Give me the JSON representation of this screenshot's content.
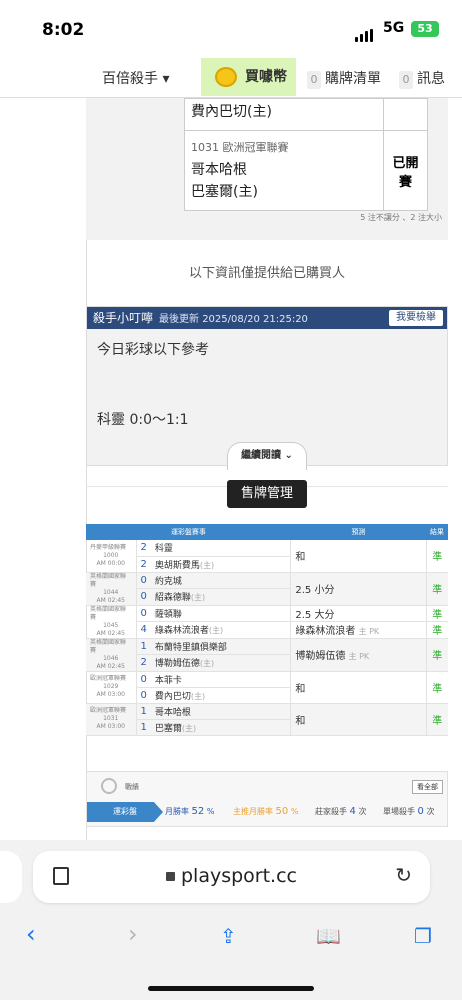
{
  "status_bar": {
    "time": "8:02",
    "network": "5G",
    "battery": "53"
  },
  "top_nav": {
    "menu_label": "百倍殺手 ▾",
    "buy_label": "買噱幣",
    "cart_count": "0",
    "cart_label": "購牌清單",
    "msg_count": "0",
    "msg_label": "訊息"
  },
  "prediction_table": {
    "rows": [
      {
        "league": "",
        "team1": "費內巴切(主)",
        "team2": "",
        "result": ""
      },
      {
        "league": "1031 歐洲冠軍聯賽",
        "team1": "哥本哈根",
        "team2": "巴塞爾(主)",
        "result": "已開賽"
      }
    ],
    "footnote": "5 注不讓分 、2 注大小"
  },
  "notice": "以下資訊僅提供給已購買人",
  "alert_box": {
    "title": "殺手小叮嚀",
    "updated": "最後更新 2025/08/20 21:25:20",
    "report_button": "我要檢舉",
    "line1": "今日彩球以下參考",
    "line2": "科靈 0:0～1:1"
  },
  "read_more": "繼續閱讀 ⌄",
  "sell_button": "售牌管理",
  "records": {
    "headers": [
      "運彩盤賽事",
      "預測",
      "結果"
    ],
    "rows": [
      {
        "league": "丹麥甲級聯賽",
        "num": "1000",
        "time": "AM 00:00",
        "s1": "2",
        "t1": "科靈",
        "s2": "2",
        "t2": "奧胡斯費馬",
        "t2h": "(主)",
        "pick1": "和",
        "pk1": "",
        "pick2": "",
        "pk2": "",
        "res": "準"
      },
      {
        "league": "英格蘭國家聯賽",
        "num": "1044",
        "time": "AM 02:45",
        "s1": "0",
        "t1": "約克城",
        "s2": "0",
        "t2": "紹森德聯",
        "t2h": "(主)",
        "pick1": "2.5 小分",
        "pk1": "",
        "pick2": "",
        "pk2": "",
        "res": "準"
      },
      {
        "league": "英格蘭國家聯賽",
        "num": "1045",
        "time": "AM 02:45",
        "s1": "0",
        "t1": "薩頓聯",
        "s2": "4",
        "t2": "綠森林流浪者",
        "t2h": "(主)",
        "pick1": "2.5 大分",
        "pk1": "",
        "pick2": "綠森林流浪者",
        "pk2": "主 PK",
        "res": "準",
        "res2": "準"
      },
      {
        "league": "英格蘭國家聯賽",
        "num": "1046",
        "time": "AM 02:45",
        "s1": "1",
        "t1": "布蘭特里鎮俱樂部",
        "s2": "2",
        "t2": "博勒姆伍德",
        "t2h": "(主)",
        "pick1": "博勒姆伍德",
        "pk1": "主 PK",
        "pick2": "",
        "pk2": "",
        "res": "準"
      },
      {
        "league": "歐洲冠軍聯賽",
        "num": "1029",
        "time": "AM 03:00",
        "s1": "0",
        "t1": "本菲卡",
        "s2": "0",
        "t2": "費內巴切",
        "t2h": "(主)",
        "pick1": "和",
        "pk1": "",
        "pick2": "",
        "pk2": "",
        "res": "準"
      },
      {
        "league": "歐洲冠軍聯賽",
        "num": "1031",
        "time": "AM 03:00",
        "s1": "1",
        "t1": "哥本哈根",
        "s2": "1",
        "t2": "巴塞爾",
        "t2h": "(主)",
        "pick1": "和",
        "pk1": "",
        "pick2": "",
        "pk2": "",
        "res": "準"
      }
    ]
  },
  "stats": {
    "label": "戰績",
    "view_all": "看全部",
    "arrow_label": "運彩盤",
    "month_rate_label": "月勝率",
    "month_rate": "52",
    "main_rate_label": "主推月勝率",
    "main_rate": "50",
    "killer_label": "莊家殺手",
    "killer": "4",
    "single_label": "單場殺手",
    "single": "0"
  },
  "browser": {
    "host": "playsport.cc"
  },
  "colors": {
    "nav_buy_bg": "#dbf5b8",
    "header_blue": "#2c4a7c",
    "table_blue": "#3a86c8",
    "correct_green": "#2fae2f",
    "ios_blue": "#1a73e8"
  }
}
